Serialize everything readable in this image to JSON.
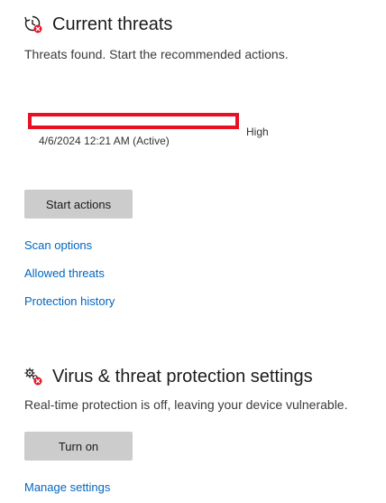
{
  "threats": {
    "title": "Current threats",
    "description": "Threats found. Start the recommended actions.",
    "item": {
      "date": "4/6/2024 12:21 AM (Active)",
      "severity": "High"
    },
    "start_actions_label": "Start actions",
    "links": [
      "Scan options",
      "Allowed threats",
      "Protection history"
    ]
  },
  "settings": {
    "title": "Virus & threat protection settings",
    "description": "Real-time protection is off, leaving your device vulnerable.",
    "turn_on_label": "Turn on",
    "manage_label": "Manage settings"
  },
  "colors": {
    "alert_red": "#e81123",
    "link_blue": "#0067c0",
    "button_gray": "#cccccc"
  },
  "icons": {
    "threats_icon": "history-alert-icon",
    "settings_icon": "gears-alert-icon"
  }
}
